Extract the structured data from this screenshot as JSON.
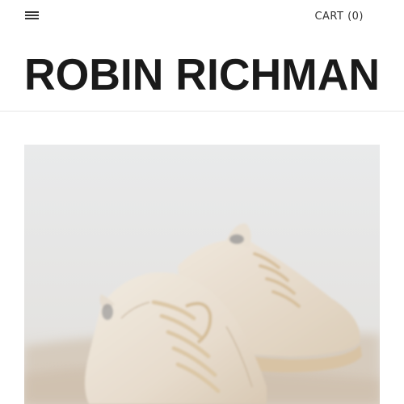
{
  "header": {
    "menu_icon": "hamburger-menu-icon",
    "cart_label": "CART",
    "cart_count": "(0)",
    "logo_text": "ROBIN RICHMAN"
  },
  "hero": {
    "image_subject": "cream leather lace-up sneakers",
    "colors": {
      "background": "#e8e9ea",
      "leather": "#ece3d6",
      "sole": "#d9c4a6",
      "laces": "#e2cfb2",
      "surface": "#d8cdbf"
    }
  }
}
